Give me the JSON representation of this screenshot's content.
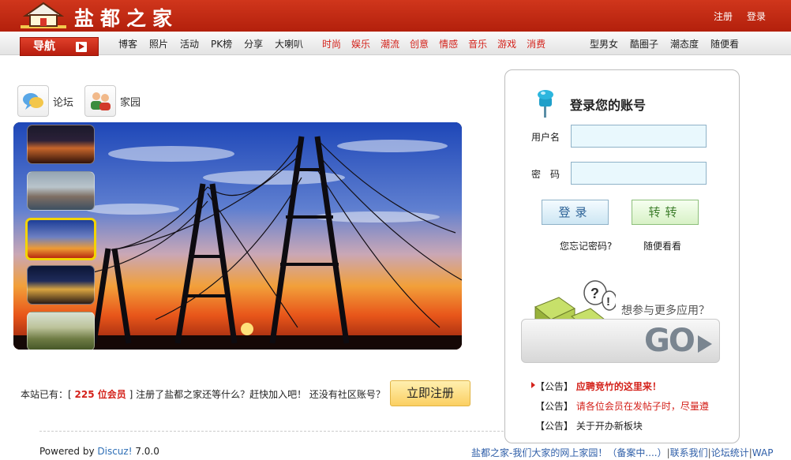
{
  "header": {
    "site_name": "盐都之家",
    "top_links": [
      "注册",
      "登录"
    ]
  },
  "nav": {
    "button_label": "导航",
    "group1": [
      "博客",
      "照片",
      "活动",
      "PK榜",
      "分享",
      "大喇叭"
    ],
    "group2": [
      "时尚",
      "娱乐",
      "潮流",
      "创意",
      "情感",
      "音乐",
      "游戏",
      "消费"
    ],
    "group3": [
      "型男女",
      "酷圈子",
      "潮态度",
      "随便看"
    ],
    "group2_color": "#d4221b"
  },
  "quick": {
    "forum_label": "论坛",
    "home_label": "家园"
  },
  "slideshow": {
    "thumbnail_count": 5,
    "active_index": 2
  },
  "register": {
    "prefix": "本站已有：[",
    "count": "225 位会员",
    "suffix": "] 注册了盐都之家还等什么？赶快加入吧！ 还没有社区账号？",
    "button": "立即注册"
  },
  "login": {
    "title": "登录您的账号",
    "username_label": "用户名",
    "password_label": "密　码",
    "username_value": "",
    "password_value": "",
    "login_button": "登录",
    "jump_button": "转转",
    "forgot_link": "您忘记密码?",
    "browse_link": "随便看看",
    "more_apps": "想参与更多应用？",
    "go_label": "GO"
  },
  "notices": [
    {
      "tag": "【公告】",
      "text": "应聘竞竹的这里来！"
    },
    {
      "tag": "【公告】",
      "text": "请各位会员在发帖子时，尽量遵"
    },
    {
      "tag": "【公告】",
      "text": "关于开办新板块"
    }
  ],
  "footer": {
    "powered_prefix": "Powered by ",
    "powered_brand": "Discuz!",
    "powered_version": " 7.0.0",
    "site_slogan": "盐都之家-我们大家的网上家园！",
    "icp": "（备案中....）",
    "contact": "联系我们",
    "stats": "论坛统计",
    "wap": "WAP"
  },
  "colors": {
    "header_red": "#c12a12",
    "accent_red": "#d4221b",
    "link_blue": "#2e5ea8"
  }
}
